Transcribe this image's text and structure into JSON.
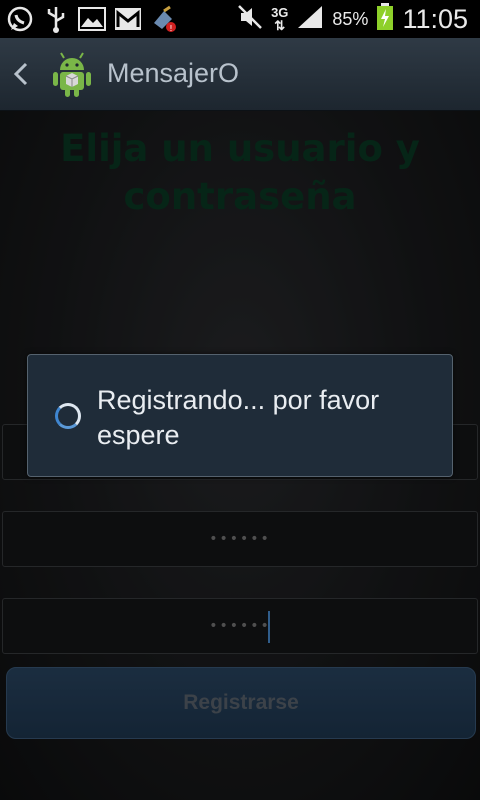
{
  "status_bar": {
    "battery_percent": "85%",
    "network": "3G",
    "time": "11:05",
    "icons": [
      "whatsapp-icon",
      "usb-icon",
      "gallery-icon",
      "gmail-icon",
      "cleaner-icon",
      "mute-icon",
      "network-3g-icon",
      "signal-icon",
      "battery-charging-icon"
    ]
  },
  "action_bar": {
    "title": "MensajerO",
    "back_icon": "chevron-left-icon",
    "logo_icon": "android-icon"
  },
  "main": {
    "heading": "Elija un usuario y contraseña",
    "password_mask": "••••••",
    "confirm_password_mask": "••••••",
    "register_button": "Registrarse"
  },
  "dialog": {
    "message": "Registrando... por favor espere"
  },
  "colors": {
    "heading": "#0a3a24",
    "dialog_bg": "#1f2c39",
    "button_bg": "#2a4663",
    "caret": "#4a8fd6"
  }
}
